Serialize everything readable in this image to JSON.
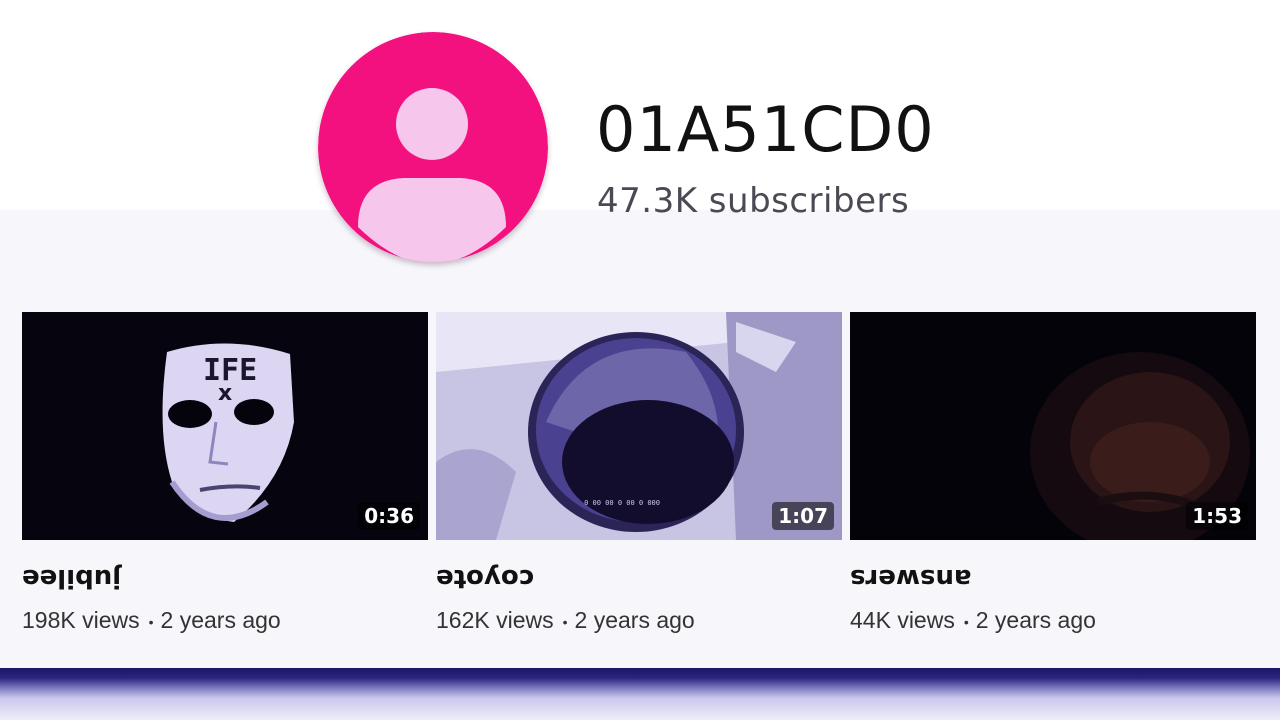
{
  "channel": {
    "name": "01A51CD0",
    "subscribers": "47.3K subscribers",
    "avatar_icon": "default-user-avatar-icon",
    "avatar_color": "#f2117f"
  },
  "videos": [
    {
      "title": "jubilee",
      "views": "198K views",
      "age": "2 years ago",
      "duration": "0:36",
      "thumbnail": "white-mask-face",
      "thumbnail_text": "IFE"
    },
    {
      "title": "coyote",
      "views": "162K views",
      "age": "2 years ago",
      "duration": "1:07",
      "thumbnail": "dark-hole-fisheye"
    },
    {
      "title": "answers",
      "views": "44K views",
      "age": "2 years ago",
      "duration": "1:53",
      "thumbnail": "dark-face"
    }
  ],
  "meta_separator": "•",
  "colors": {
    "accent_tint": "#5a4fb0",
    "bottom_bar": "#1a1666"
  }
}
